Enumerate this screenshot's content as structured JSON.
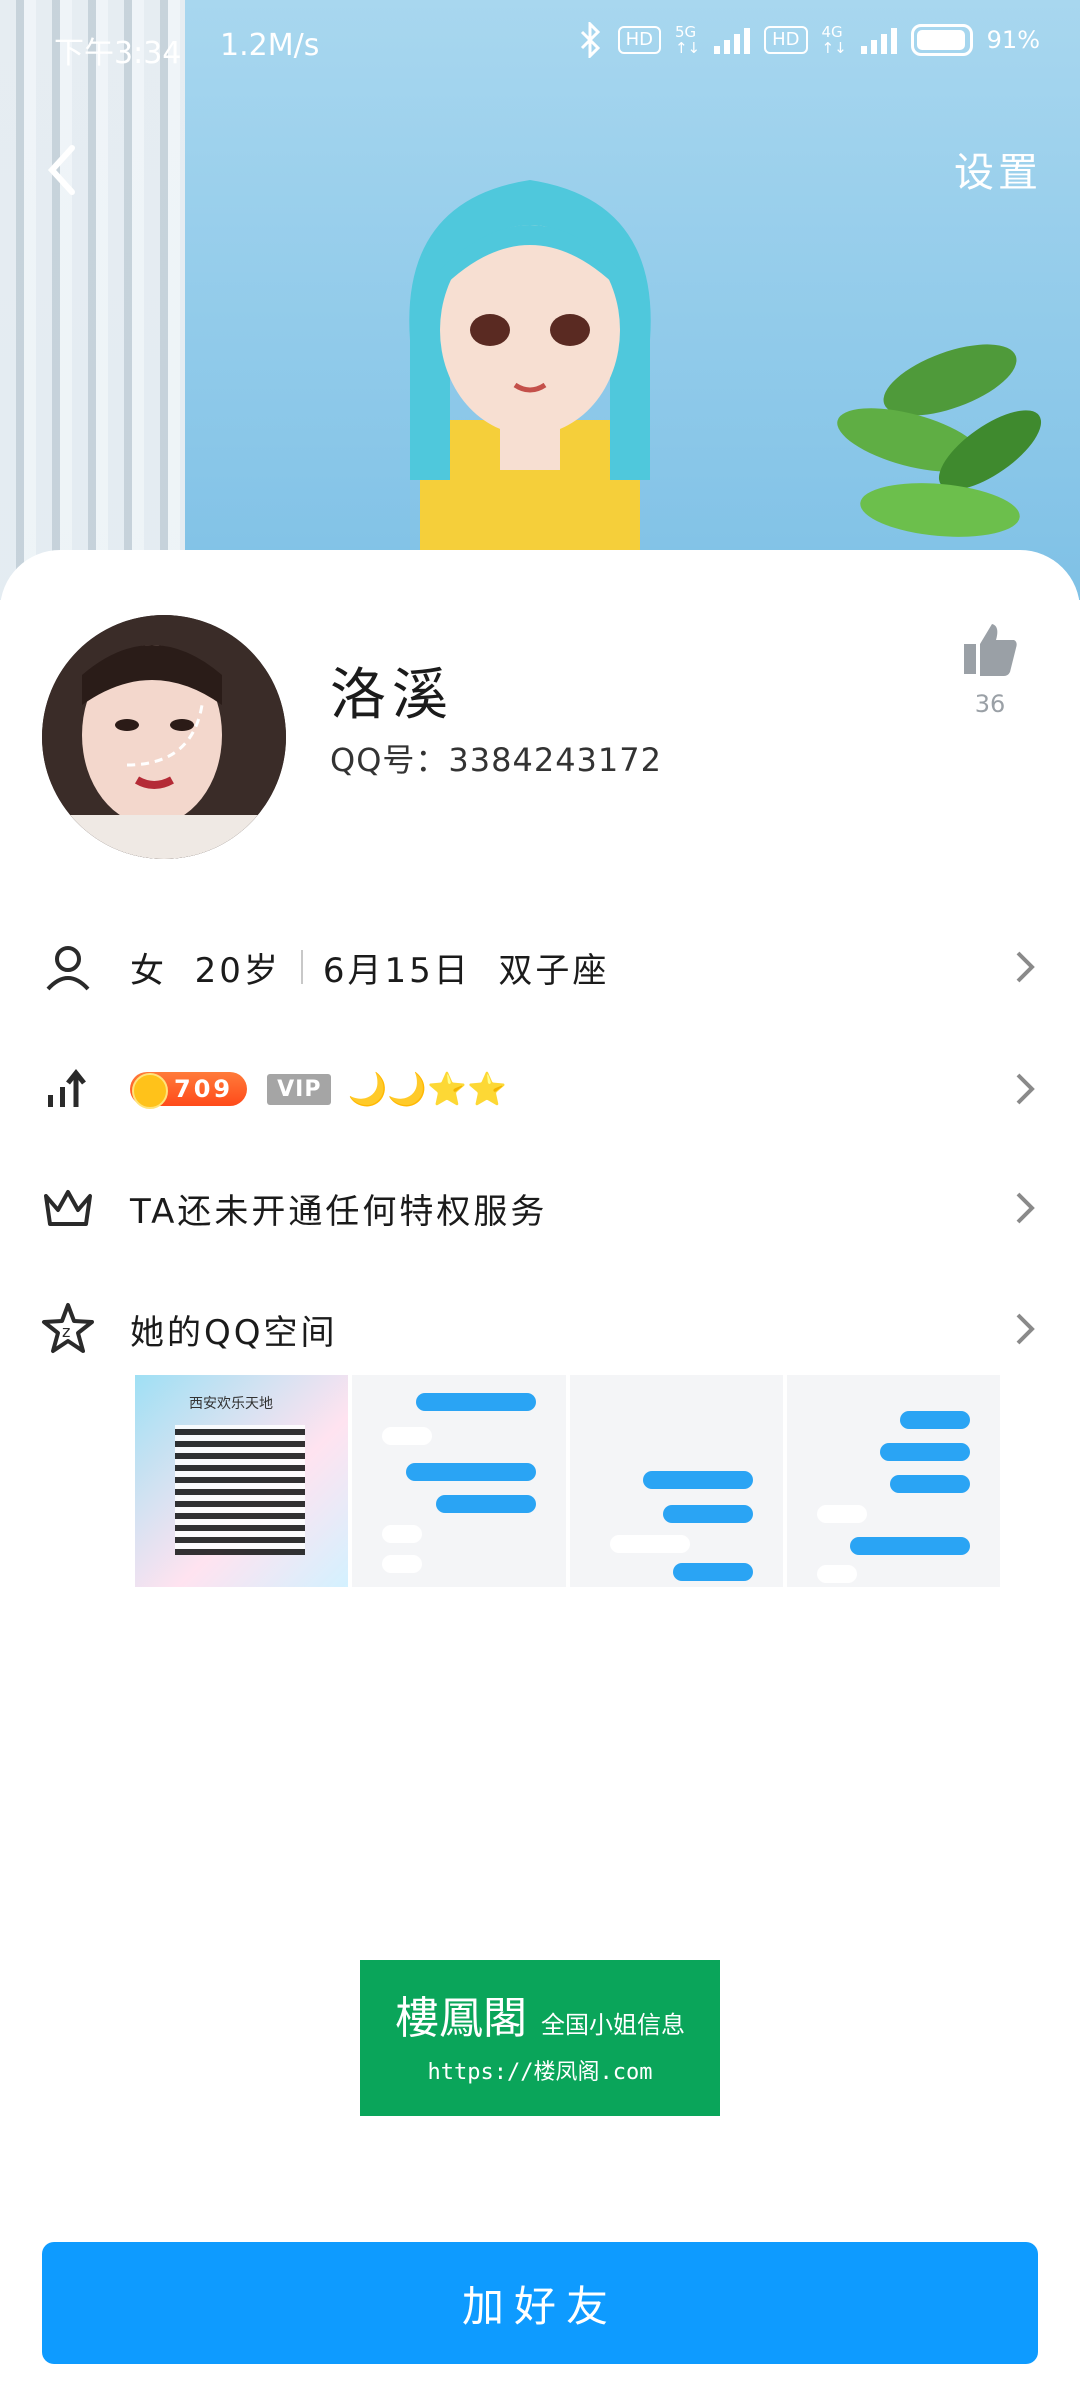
{
  "status_bar": {
    "time": "下午3:34",
    "speed": "1.2M/s",
    "hd1": "HD",
    "net1": "5G",
    "hd2": "HD",
    "net2": "4G",
    "battery": "91%"
  },
  "header": {
    "settings_label": "设置"
  },
  "profile": {
    "nickname": "洛溪",
    "qq_label": "QQ号：",
    "qq_number": "3384243172",
    "like_count": "36"
  },
  "info_rows": {
    "basic": {
      "gender": "女",
      "age": "20岁",
      "birthday": "6月15日",
      "zodiac": "双子座"
    },
    "level": {
      "level_value": "709",
      "vip_label": "VIP",
      "level_icons": "🌙🌙⭐⭐"
    },
    "privilege": {
      "text": "TA还未开通任何特权服务"
    },
    "qzone": {
      "text": "她的QQ空间"
    }
  },
  "qzone_photos": [
    {
      "caption": "西安欢乐天地"
    },
    {
      "caption": ""
    },
    {
      "caption": ""
    },
    {
      "caption": ""
    }
  ],
  "ad": {
    "title": "樓鳳閣",
    "subtitle": "全国小姐信息",
    "url": "https://楼凤阁.com"
  },
  "actions": {
    "add_friend_label": "加好友"
  },
  "colors": {
    "accent": "#0e9bff",
    "ad_green": "#0aa55a",
    "level_orange": "#ff5a24"
  }
}
